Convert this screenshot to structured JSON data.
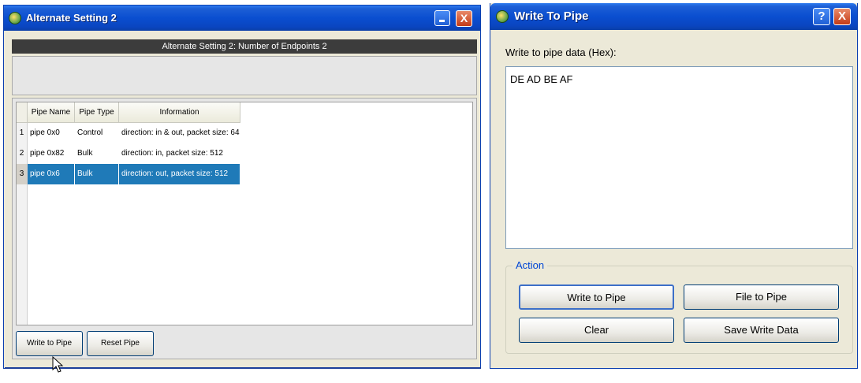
{
  "left_window": {
    "title": "Alternate Setting 2",
    "header": "Alternate Setting 2: Number of Endpoints 2",
    "columns": [
      "Pipe Name",
      "Pipe Type",
      "Information"
    ],
    "rows": [
      {
        "num": "1",
        "name": "pipe 0x0",
        "type": "Control",
        "info": "direction: in & out, packet size: 64"
      },
      {
        "num": "2",
        "name": "pipe 0x82",
        "type": "Bulk",
        "info": "direction: in, packet size: 512"
      },
      {
        "num": "3",
        "name": "pipe 0x6",
        "type": "Bulk",
        "info": "direction: out, packet size: 512"
      }
    ],
    "buttons": {
      "write": "Write to Pipe",
      "reset": "Reset Pipe"
    },
    "close_glyph": "X"
  },
  "right_window": {
    "title": "Write To Pipe",
    "help_glyph": "?",
    "close_glyph": "X",
    "data_label": "Write to pipe data (Hex):",
    "data_value": "DE AD BE AF",
    "action_label": "Action",
    "buttons": {
      "write": "Write to Pipe",
      "file": "File to Pipe",
      "clear": "Clear",
      "save": "Save Write Data"
    }
  },
  "colors": {
    "titlebar": "#0a4ed0",
    "selection": "#1f7ab8",
    "header_bar": "#3c3c3c",
    "action_label": "#0046d5"
  },
  "icons": [
    "app-icon",
    "minimize-icon",
    "close-icon",
    "help-icon",
    "mouse-cursor-icon"
  ]
}
